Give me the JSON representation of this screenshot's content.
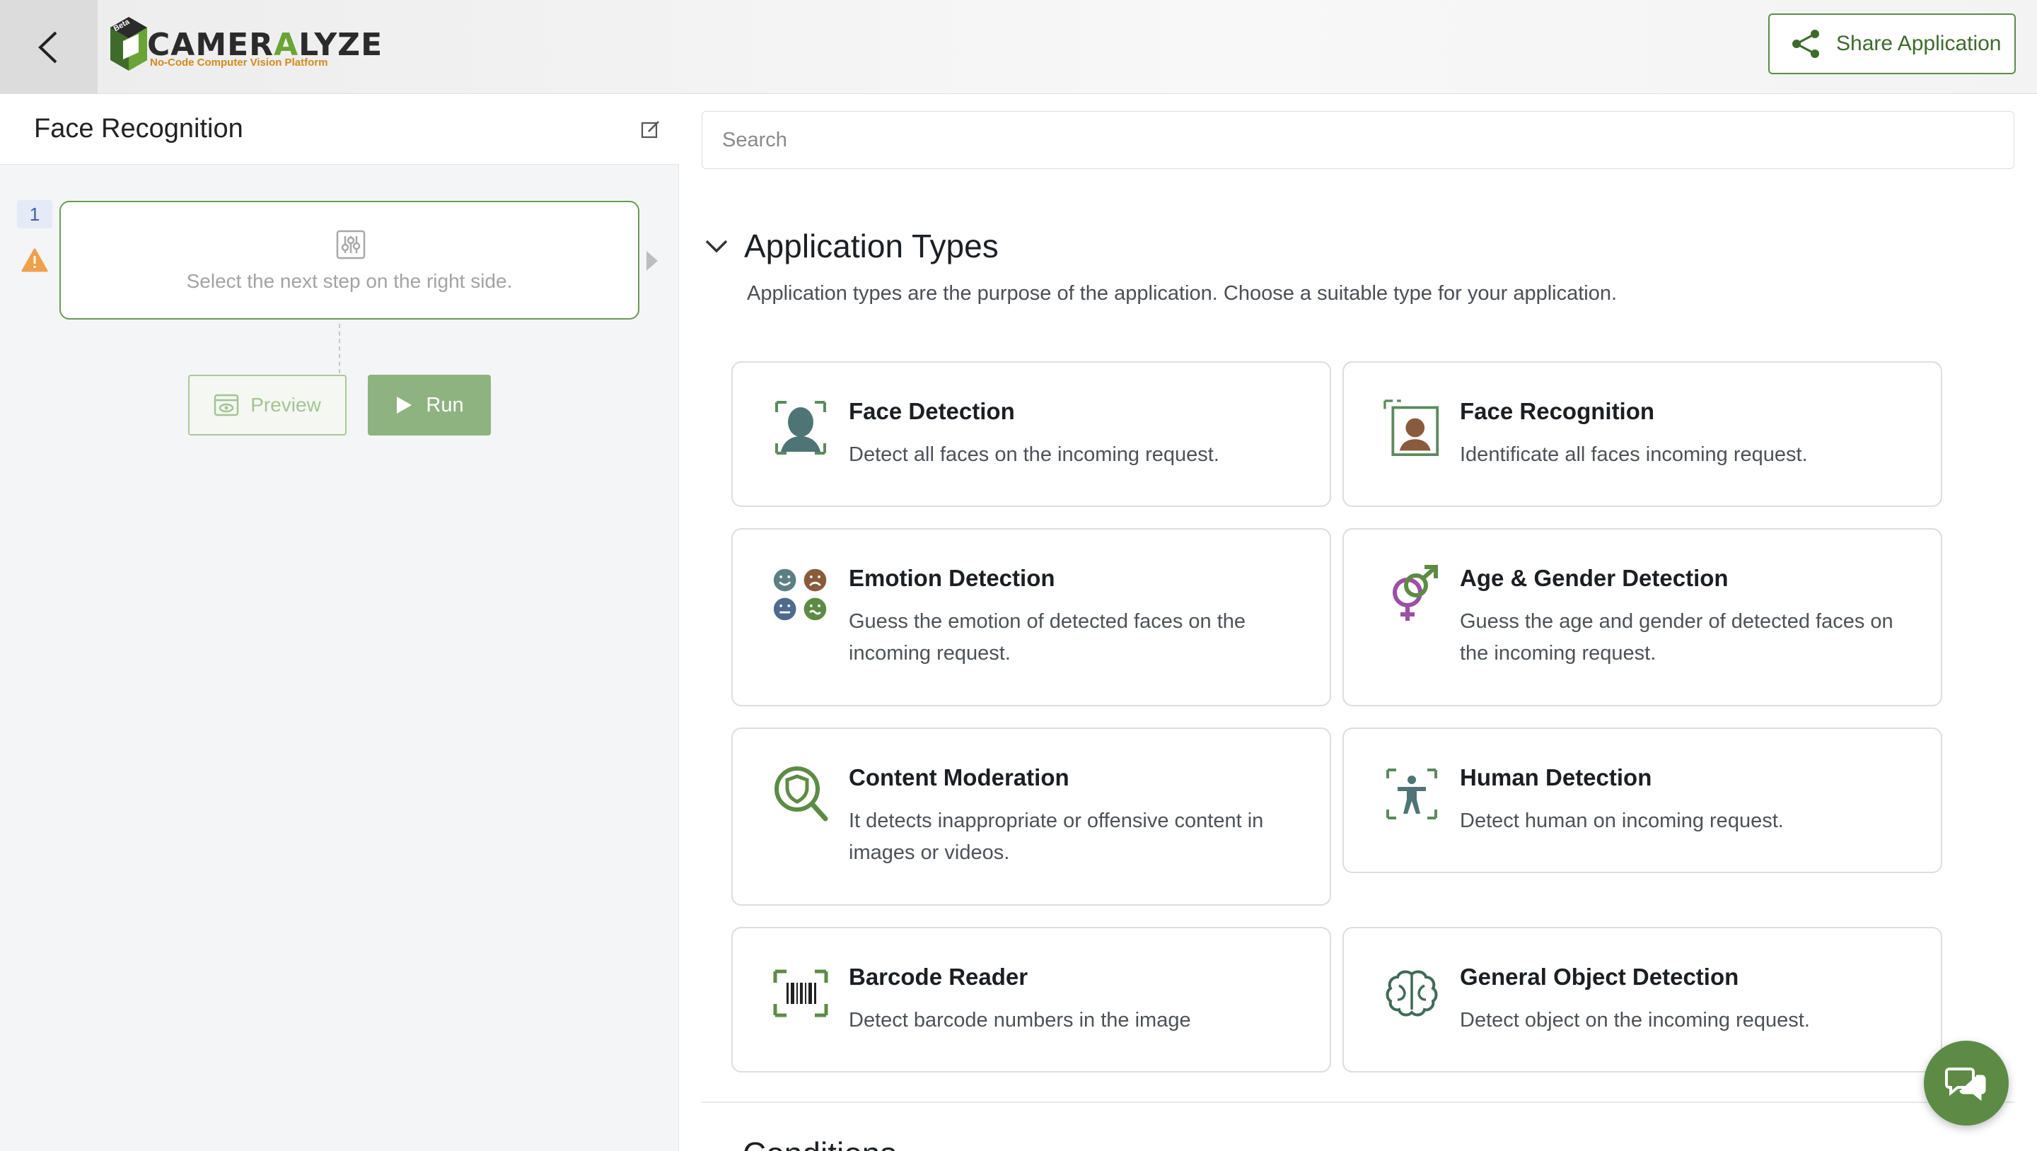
{
  "header": {
    "back_icon": "chevron-left-icon",
    "logo": {
      "brand_prefix": "CAMER",
      "brand_a": "A",
      "brand_suffix": "LYZE",
      "tagline": "No-Code Computer Vision Platform",
      "badge": "Beta"
    },
    "share_label": "Share Application",
    "share_icon": "share-icon"
  },
  "left": {
    "app_title": "Face Recognition",
    "step_number": "1",
    "step_placeholder": "Select the next step on the right side.",
    "preview_label": "Preview",
    "run_label": "Run"
  },
  "right": {
    "search_placeholder": "Search",
    "section_title": "Application Types",
    "section_desc": "Application types are the purpose of the application. Choose a suitable type for your application.",
    "cards": [
      {
        "title": "Face Detection",
        "desc": "Detect all faces on the incoming request.",
        "icon": "face-scan-icon"
      },
      {
        "title": "Face Recognition",
        "desc": "Identificate all faces incoming request.",
        "icon": "face-id-icon"
      },
      {
        "title": "Emotion Detection",
        "desc": "Guess the emotion of detected faces on the incoming request.",
        "icon": "emotion-faces-icon"
      },
      {
        "title": "Age & Gender Detection",
        "desc": "Guess the age and gender of detected faces on the incoming request.",
        "icon": "gender-symbol-icon"
      },
      {
        "title": "Content Moderation",
        "desc": "It detects inappropriate or offensive content in images or videos.",
        "icon": "shield-search-icon"
      },
      {
        "title": "Human Detection",
        "desc": "Detect human on incoming request.",
        "icon": "human-scan-icon"
      },
      {
        "title": "Barcode Reader",
        "desc": "Detect barcode numbers in the image",
        "icon": "barcode-icon"
      },
      {
        "title": "General Object Detection",
        "desc": "Detect object on the incoming request.",
        "icon": "brain-icon"
      }
    ],
    "next_section_title": "Conditions"
  },
  "colors": {
    "accent": "#5d8b45",
    "warning": "#f0a04b",
    "step_border": "#6a9a56"
  }
}
